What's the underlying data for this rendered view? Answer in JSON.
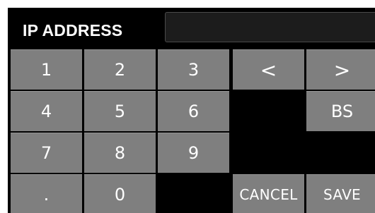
{
  "header": {
    "title": "IP ADDRESS",
    "ip_value": ""
  },
  "keypad": {
    "row1": {
      "k1": "1",
      "k2": "2",
      "k3": "3",
      "left": "<",
      "right": ">"
    },
    "row2": {
      "k4": "4",
      "k5": "5",
      "k6": "6",
      "bs": "BS"
    },
    "row3": {
      "k7": "7",
      "k8": "8",
      "k9": "9"
    },
    "row4": {
      "dot": ".",
      "k0": "0",
      "cancel": "CANCEL",
      "save": "SAVE"
    }
  },
  "colors": {
    "background": "#000000",
    "key": "#7f7f7f",
    "text": "#ffffff"
  }
}
